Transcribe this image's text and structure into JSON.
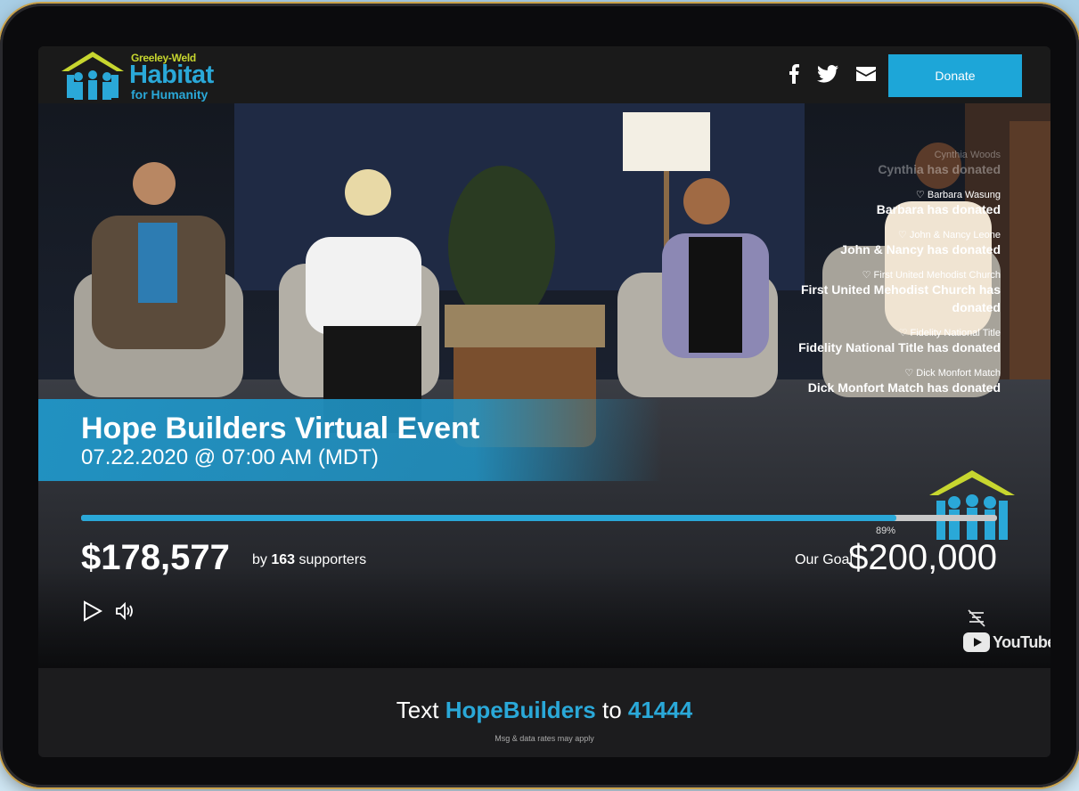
{
  "header": {
    "logo_small": "Greeley-Weld",
    "logo_big": "Habitat",
    "logo_sub": "for Humanity",
    "donate_label": "Donate",
    "social": [
      "facebook-icon",
      "twitter-icon",
      "envelope-icon"
    ]
  },
  "event": {
    "title": "Hope Builders Virtual Event",
    "date": "07.22.2020 @ 07:00 AM (MDT)"
  },
  "donors": [
    {
      "name": "Cynthia Woods",
      "message": "Cynthia has donated",
      "faded": true
    },
    {
      "name": "Barbara Wasung",
      "message": "Barbara has donated",
      "faded": false
    },
    {
      "name": "John & Nancy Leone",
      "message": "John & Nancy has donated",
      "faded": false
    },
    {
      "name": "First United Mehodist Church",
      "message": "First United Mehodist Church has donated",
      "faded": false
    },
    {
      "name": "Fidelity National Title",
      "message": "Fidelity National Title has donated",
      "faded": false
    },
    {
      "name": "Dick Monfort Match",
      "message": "Dick Monfort Match has donated",
      "faded": false
    }
  ],
  "fundraising": {
    "raised": "$178,577",
    "by_prefix": "by",
    "supporters": "163",
    "supporters_suffix": "supporters",
    "goal_label": "Our Goal",
    "goal": "$200,000",
    "percent_label": "89%",
    "progress": 0.89
  },
  "player": {
    "youtube_label": "YouTube"
  },
  "footer": {
    "text_prefix": "Text",
    "keyword": "HopeBuilders",
    "to": "to",
    "number": "41444",
    "disclaimer": "Msg & data rates may apply"
  },
  "colors": {
    "accent": "#2aa8d8",
    "logo_green": "#c7d62f"
  }
}
